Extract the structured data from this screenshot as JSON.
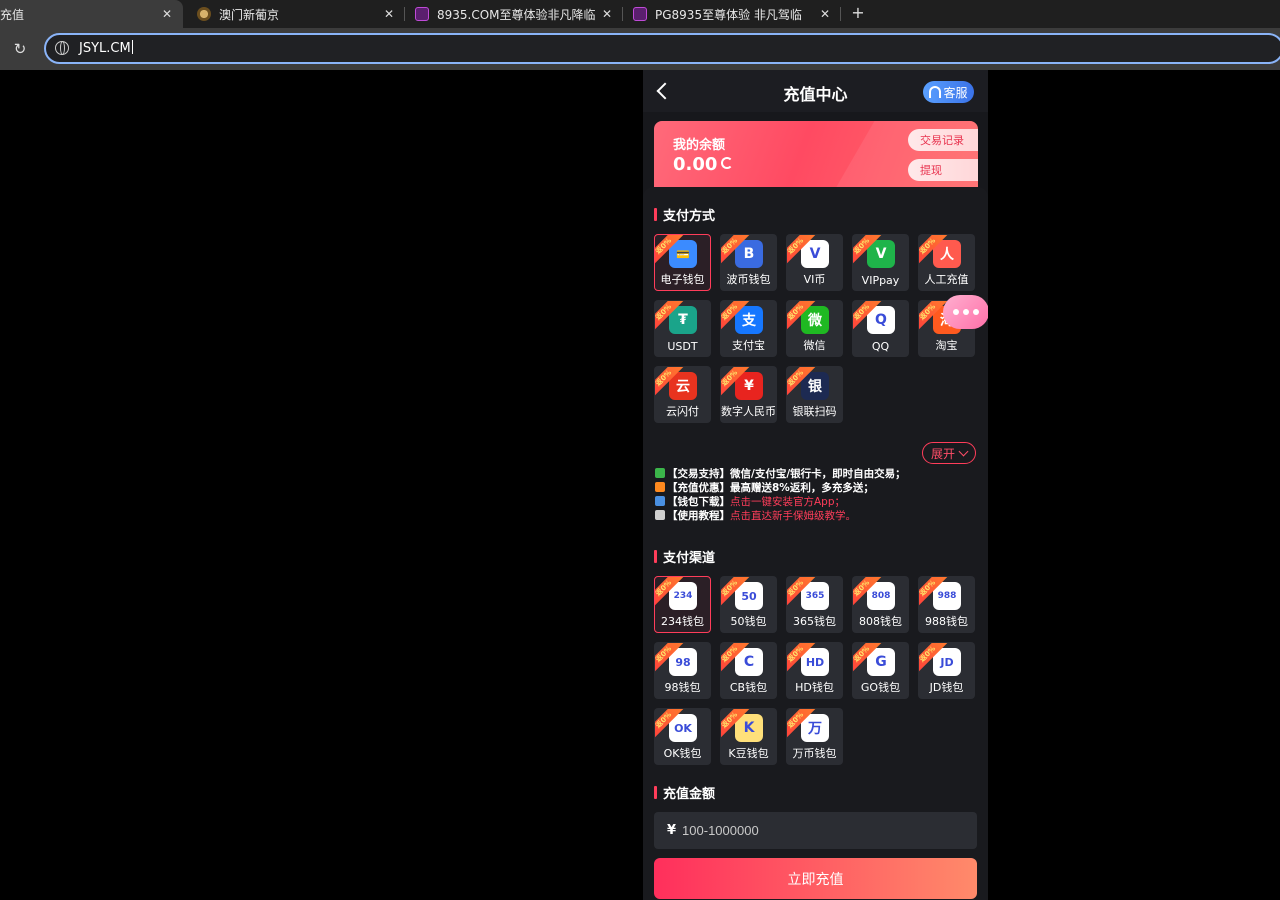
{
  "browser": {
    "tabs": [
      {
        "title": "充值",
        "active": true
      },
      {
        "title": "澳门新葡京",
        "active": false
      },
      {
        "title": "8935.COM至尊体验非凡降临",
        "active": false
      },
      {
        "title": "PG8935至尊体验 非凡驾临",
        "active": false
      }
    ],
    "close_glyph": "✕",
    "new_tab_glyph": "+",
    "reload_glyph": "↻",
    "url": "JSYL.CM"
  },
  "header": {
    "title": "充值中心",
    "service_label": "客服"
  },
  "balance": {
    "label": "我的余额",
    "value": "0.00",
    "records_label": "交易记录",
    "withdraw_label": "提现"
  },
  "payment_methods": {
    "title": "支付方式",
    "badge": "返0%",
    "items": [
      {
        "label": "电子钱包",
        "color": "#3b8bff",
        "glyph": "💳"
      },
      {
        "label": "波币钱包",
        "color": "#3a6be0",
        "glyph": "B"
      },
      {
        "label": "VI币",
        "color": "#ffffff",
        "glyph": "V"
      },
      {
        "label": "VIPpay",
        "color": "#1fb44a",
        "glyph": "V"
      },
      {
        "label": "人工充值",
        "color": "#ff5a4e",
        "glyph": "人"
      },
      {
        "label": "USDT",
        "color": "#1aa48a",
        "glyph": "₮"
      },
      {
        "label": "支付宝",
        "color": "#1677ff",
        "glyph": "支"
      },
      {
        "label": "微信",
        "color": "#1fb922",
        "glyph": "微"
      },
      {
        "label": "QQ",
        "color": "#ffffff",
        "glyph": "Q"
      },
      {
        "label": "淘宝",
        "color": "#ff5a1f",
        "glyph": "淘"
      },
      {
        "label": "云闪付",
        "color": "#e8331f",
        "glyph": "云"
      },
      {
        "label": "数字人民币",
        "color": "#e8241f",
        "glyph": "¥"
      },
      {
        "label": "银联扫码",
        "color": "#1d2a52",
        "glyph": "银"
      }
    ],
    "expand_label": "展开"
  },
  "notes": [
    {
      "prefix": "【交易支持】微信/支付宝/银行卡，即时自由交易；",
      "highlight": "",
      "icon_color": "#3bb54a"
    },
    {
      "prefix": "【充值优惠】最高赠送8%返利，多充多送；",
      "highlight": "",
      "icon_color": "#ff8a1f"
    },
    {
      "prefix": "【钱包下载】",
      "highlight": "点击一键安装官方App；",
      "icon_color": "#4a90e2"
    },
    {
      "prefix": "【使用教程】",
      "highlight": "点击直达新手保姆级教学。",
      "icon_color": "#d0d0d0"
    }
  ],
  "channels": {
    "title": "支付渠道",
    "badge": "返0%",
    "items": [
      {
        "label": "234钱包",
        "color": "#ffffff",
        "glyph": "234"
      },
      {
        "label": "50钱包",
        "color": "#ffffff",
        "glyph": "50"
      },
      {
        "label": "365钱包",
        "color": "#ffffff",
        "glyph": "365"
      },
      {
        "label": "808钱包",
        "color": "#ffffff",
        "glyph": "808"
      },
      {
        "label": "988钱包",
        "color": "#ffffff",
        "glyph": "988"
      },
      {
        "label": "98钱包",
        "color": "#ffffff",
        "glyph": "98"
      },
      {
        "label": "CB钱包",
        "color": "#ffffff",
        "glyph": "C"
      },
      {
        "label": "HD钱包",
        "color": "#ffffff",
        "glyph": "HD"
      },
      {
        "label": "GO钱包",
        "color": "#ffffff",
        "glyph": "G"
      },
      {
        "label": "JD钱包",
        "color": "#ffffff",
        "glyph": "JD"
      },
      {
        "label": "OK钱包",
        "color": "#ffffff",
        "glyph": "OK"
      },
      {
        "label": "K豆钱包",
        "color": "#ffe07a",
        "glyph": "K"
      },
      {
        "label": "万币钱包",
        "color": "#ffffff",
        "glyph": "万"
      }
    ]
  },
  "amount": {
    "title": "充值金额",
    "currency": "¥",
    "placeholder": "100-1000000"
  },
  "submit_label": "立即充值"
}
